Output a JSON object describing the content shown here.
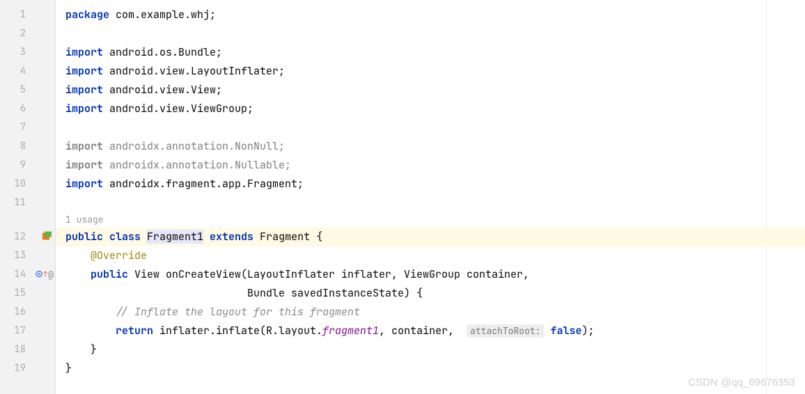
{
  "gutter": {
    "lines": [
      "1",
      "2",
      "3",
      "4",
      "5",
      "6",
      "7",
      "8",
      "9",
      "10",
      "11",
      "",
      "12",
      "13",
      "14",
      "15",
      "16",
      "17",
      "18",
      "19"
    ]
  },
  "usage": {
    "text": "1 usage"
  },
  "code": {
    "l1_kw": "package",
    "l1_rest": " com.example.whj;",
    "l3_kw": "import",
    "l3_rest": " android.os.Bundle;",
    "l4_kw": "import",
    "l4_rest": " android.view.LayoutInflater;",
    "l5_kw": "import",
    "l5_rest": " android.view.View;",
    "l6_kw": "import",
    "l6_rest": " android.view.ViewGroup;",
    "l8_kw": "import ",
    "l8_rest": "androidx.annotation.NonNull;",
    "l9_kw": "import ",
    "l9_rest": "androidx.annotation.Nullable;",
    "l10_kw": "import",
    "l10_rest": " androidx.fragment.app.Fragment;",
    "l12_public": "public ",
    "l12_class": "class ",
    "l12_name": "Fragment1",
    "l12_extends": " extends ",
    "l12_parent": "Fragment {",
    "l13_indent": "    ",
    "l13_annotation": "@Override",
    "l14_indent": "    ",
    "l14_public": "public ",
    "l14_rest": "View onCreateView(LayoutInflater inflater, ViewGroup container,",
    "l15_indent": "                             ",
    "l15_rest": "Bundle savedInstanceState) {",
    "l16_indent": "        ",
    "l16_comment": "// Inflate the layout for this fragment",
    "l17_indent": "        ",
    "l17_return": "return ",
    "l17_mid1": "inflater.inflate(R.layout.",
    "l17_frag": "fragment1",
    "l17_mid2": ", container,  ",
    "l17_hint": "attachToRoot:",
    "l17_space": " ",
    "l17_false": "false",
    "l17_end": ");",
    "l18_indent": "    ",
    "l18_brace": "}",
    "l19_brace": "}"
  },
  "watermark": "CSDN @qq_69676353"
}
